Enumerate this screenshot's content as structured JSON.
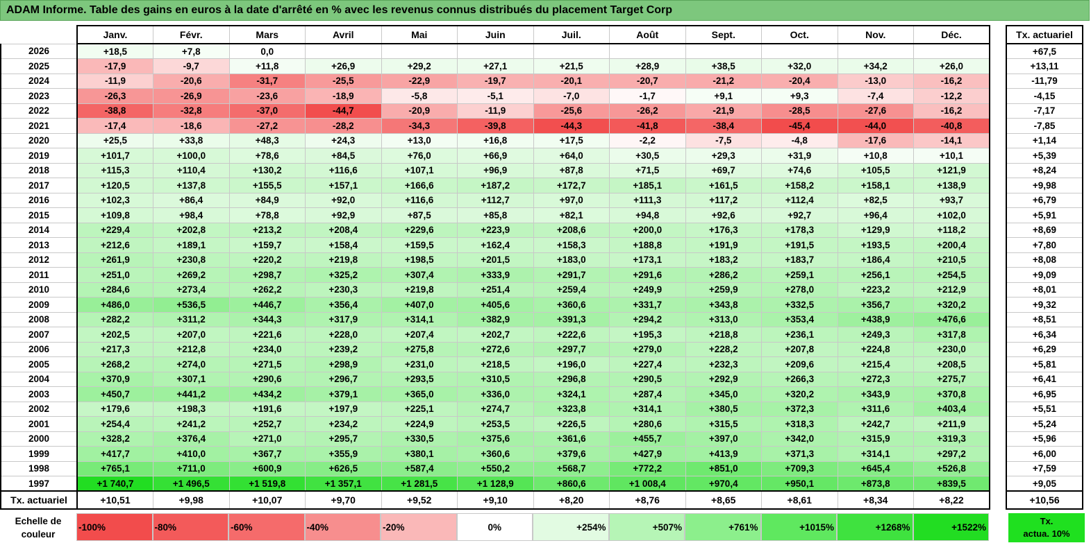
{
  "title": "ADAM Informe. Table des gains en euros à la date d'arrêté en % avec les revenus connus distribués du placement Target Corp",
  "months": [
    "Janv.",
    "Févr.",
    "Mars",
    "Avril",
    "Mai",
    "Juin",
    "Juil.",
    "Août",
    "Sept.",
    "Oct.",
    "Nov.",
    "Déc."
  ],
  "actuarial_header": "Tx. actuariel",
  "rows": [
    {
      "year": "2026",
      "values": [
        "+18,5",
        "+7,8",
        "0,0",
        "",
        "",
        "",
        "",
        "",
        "",
        "",
        "",
        ""
      ],
      "act": "+67,5"
    },
    {
      "year": "2025",
      "values": [
        "-17,9",
        "-9,7",
        "+11,8",
        "+26,9",
        "+29,2",
        "+27,1",
        "+21,5",
        "+28,9",
        "+38,5",
        "+32,0",
        "+34,2",
        "+26,0"
      ],
      "act": "+13,11"
    },
    {
      "year": "2024",
      "values": [
        "-11,9",
        "-20,6",
        "-31,7",
        "-25,5",
        "-22,9",
        "-19,7",
        "-20,1",
        "-20,7",
        "-21,2",
        "-20,4",
        "-13,0",
        "-16,2"
      ],
      "act": "-11,79"
    },
    {
      "year": "2023",
      "values": [
        "-26,3",
        "-26,9",
        "-23,6",
        "-18,9",
        "-5,8",
        "-5,1",
        "-7,0",
        "-1,7",
        "+9,1",
        "+9,3",
        "-7,4",
        "-12,2"
      ],
      "act": "-4,15"
    },
    {
      "year": "2022",
      "values": [
        "-38,8",
        "-32,8",
        "-37,0",
        "-44,7",
        "-20,9",
        "-11,9",
        "-25,6",
        "-26,2",
        "-21,9",
        "-28,5",
        "-27,6",
        "-16,2"
      ],
      "act": "-7,17"
    },
    {
      "year": "2021",
      "values": [
        "-17,4",
        "-18,6",
        "-27,2",
        "-28,2",
        "-34,3",
        "-39,8",
        "-44,3",
        "-41,8",
        "-38,4",
        "-45,4",
        "-44,0",
        "-40,8"
      ],
      "act": "-7,85"
    },
    {
      "year": "2020",
      "values": [
        "+25,5",
        "+33,8",
        "+48,3",
        "+24,3",
        "+13,0",
        "+16,8",
        "+17,5",
        "-2,2",
        "-7,5",
        "-4,8",
        "-17,6",
        "-14,1"
      ],
      "act": "+1,14"
    },
    {
      "year": "2019",
      "values": [
        "+101,7",
        "+100,0",
        "+78,6",
        "+84,5",
        "+76,0",
        "+66,9",
        "+64,0",
        "+30,5",
        "+29,3",
        "+31,9",
        "+10,8",
        "+10,1"
      ],
      "act": "+5,39"
    },
    {
      "year": "2018",
      "values": [
        "+115,3",
        "+110,4",
        "+130,2",
        "+116,6",
        "+107,1",
        "+96,9",
        "+87,8",
        "+71,5",
        "+69,7",
        "+74,6",
        "+105,5",
        "+121,9"
      ],
      "act": "+8,24"
    },
    {
      "year": "2017",
      "values": [
        "+120,5",
        "+137,8",
        "+155,5",
        "+157,1",
        "+166,6",
        "+187,2",
        "+172,7",
        "+185,1",
        "+161,5",
        "+158,2",
        "+158,1",
        "+138,9"
      ],
      "act": "+9,98"
    },
    {
      "year": "2016",
      "values": [
        "+102,3",
        "+86,4",
        "+84,9",
        "+92,0",
        "+116,6",
        "+112,7",
        "+97,0",
        "+111,3",
        "+117,2",
        "+112,4",
        "+82,5",
        "+93,7"
      ],
      "act": "+6,79"
    },
    {
      "year": "2015",
      "values": [
        "+109,8",
        "+98,4",
        "+78,8",
        "+92,9",
        "+87,5",
        "+85,8",
        "+82,1",
        "+94,8",
        "+92,6",
        "+92,7",
        "+96,4",
        "+102,0"
      ],
      "act": "+5,91"
    },
    {
      "year": "2014",
      "values": [
        "+229,4",
        "+202,8",
        "+213,2",
        "+208,4",
        "+229,6",
        "+223,9",
        "+208,6",
        "+200,0",
        "+176,3",
        "+178,3",
        "+129,9",
        "+118,2"
      ],
      "act": "+8,69"
    },
    {
      "year": "2013",
      "values": [
        "+212,6",
        "+189,1",
        "+159,7",
        "+158,4",
        "+159,5",
        "+162,4",
        "+158,3",
        "+188,8",
        "+191,9",
        "+191,5",
        "+193,5",
        "+200,4"
      ],
      "act": "+7,80"
    },
    {
      "year": "2012",
      "values": [
        "+261,9",
        "+230,8",
        "+220,2",
        "+219,8",
        "+198,5",
        "+201,5",
        "+183,0",
        "+173,1",
        "+183,2",
        "+183,7",
        "+186,4",
        "+210,5"
      ],
      "act": "+8,08"
    },
    {
      "year": "2011",
      "values": [
        "+251,0",
        "+269,2",
        "+298,7",
        "+325,2",
        "+307,4",
        "+333,9",
        "+291,7",
        "+291,6",
        "+286,2",
        "+259,1",
        "+256,1",
        "+254,5"
      ],
      "act": "+9,09"
    },
    {
      "year": "2010",
      "values": [
        "+284,6",
        "+273,4",
        "+262,2",
        "+230,3",
        "+219,8",
        "+251,4",
        "+259,4",
        "+249,9",
        "+259,9",
        "+278,0",
        "+223,2",
        "+212,9"
      ],
      "act": "+8,01"
    },
    {
      "year": "2009",
      "values": [
        "+486,0",
        "+536,5",
        "+446,7",
        "+356,4",
        "+407,0",
        "+405,6",
        "+360,6",
        "+331,7",
        "+343,8",
        "+332,5",
        "+356,7",
        "+320,2"
      ],
      "act": "+9,32"
    },
    {
      "year": "2008",
      "values": [
        "+282,2",
        "+311,2",
        "+344,3",
        "+317,9",
        "+314,1",
        "+382,9",
        "+391,3",
        "+294,2",
        "+313,0",
        "+353,4",
        "+438,9",
        "+476,6"
      ],
      "act": "+8,51"
    },
    {
      "year": "2007",
      "values": [
        "+202,5",
        "+207,0",
        "+221,6",
        "+228,0",
        "+207,4",
        "+202,7",
        "+222,6",
        "+195,3",
        "+218,8",
        "+236,1",
        "+249,3",
        "+317,8"
      ],
      "act": "+6,34"
    },
    {
      "year": "2006",
      "values": [
        "+217,3",
        "+212,8",
        "+234,0",
        "+239,2",
        "+275,8",
        "+272,6",
        "+297,7",
        "+279,0",
        "+228,2",
        "+207,8",
        "+224,8",
        "+230,0"
      ],
      "act": "+6,29"
    },
    {
      "year": "2005",
      "values": [
        "+268,2",
        "+274,0",
        "+271,5",
        "+298,9",
        "+231,0",
        "+218,5",
        "+196,0",
        "+227,4",
        "+232,3",
        "+209,6",
        "+215,4",
        "+208,5"
      ],
      "act": "+5,81"
    },
    {
      "year": "2004",
      "values": [
        "+370,9",
        "+307,1",
        "+290,6",
        "+296,7",
        "+293,5",
        "+310,5",
        "+296,8",
        "+290,5",
        "+292,9",
        "+266,3",
        "+272,3",
        "+275,7"
      ],
      "act": "+6,41"
    },
    {
      "year": "2003",
      "values": [
        "+450,7",
        "+441,2",
        "+434,2",
        "+379,1",
        "+365,0",
        "+336,0",
        "+324,1",
        "+287,4",
        "+345,0",
        "+320,2",
        "+343,9",
        "+370,8"
      ],
      "act": "+6,95"
    },
    {
      "year": "2002",
      "values": [
        "+179,6",
        "+198,3",
        "+191,6",
        "+197,9",
        "+225,1",
        "+274,7",
        "+323,8",
        "+314,1",
        "+380,5",
        "+372,3",
        "+311,6",
        "+403,4"
      ],
      "act": "+5,51"
    },
    {
      "year": "2001",
      "values": [
        "+254,4",
        "+241,2",
        "+252,7",
        "+234,2",
        "+224,9",
        "+253,5",
        "+226,5",
        "+280,6",
        "+315,5",
        "+318,3",
        "+242,7",
        "+211,9"
      ],
      "act": "+5,24"
    },
    {
      "year": "2000",
      "values": [
        "+328,2",
        "+376,4",
        "+271,0",
        "+295,7",
        "+330,5",
        "+375,6",
        "+361,6",
        "+455,7",
        "+397,0",
        "+342,0",
        "+315,9",
        "+319,3"
      ],
      "act": "+5,96"
    },
    {
      "year": "1999",
      "values": [
        "+417,7",
        "+410,0",
        "+367,7",
        "+355,9",
        "+380,1",
        "+360,6",
        "+379,6",
        "+427,9",
        "+413,9",
        "+371,3",
        "+314,1",
        "+297,2"
      ],
      "act": "+6,00"
    },
    {
      "year": "1998",
      "values": [
        "+765,1",
        "+711,0",
        "+600,9",
        "+626,5",
        "+587,4",
        "+550,2",
        "+568,7",
        "+772,2",
        "+851,0",
        "+709,3",
        "+645,4",
        "+526,8"
      ],
      "act": "+7,59"
    },
    {
      "year": "1997",
      "values": [
        "+1 740,7",
        "+1 496,5",
        "+1 519,8",
        "+1 357,1",
        "+1 281,5",
        "+1 128,9",
        "+860,6",
        "+1 008,4",
        "+970,4",
        "+950,1",
        "+873,8",
        "+839,5"
      ],
      "act": "+9,05"
    }
  ],
  "summary": {
    "label": "Tx. actuariel",
    "values": [
      "+10,51",
      "+9,98",
      "+10,07",
      "+9,70",
      "+9,52",
      "+9,10",
      "+8,20",
      "+8,76",
      "+8,65",
      "+8,61",
      "+8,34",
      "+8,22"
    ],
    "act": "+10,56"
  },
  "legend": {
    "label_line1": "Echelle de",
    "label_line2": "couleur",
    "swatches": [
      {
        "text": "-100%",
        "color": "#f24c4c"
      },
      {
        "text": "-80%",
        "color": "#f35a5a"
      },
      {
        "text": "-60%",
        "color": "#f56b6b"
      },
      {
        "text": "-40%",
        "color": "#f78e8e"
      },
      {
        "text": "-20%",
        "color": "#fab8b8"
      },
      {
        "text": "0%",
        "color": "#ffffff"
      },
      {
        "text": "+254%",
        "color": "#e2fbe2"
      },
      {
        "text": "+507%",
        "color": "#b6f5b6"
      },
      {
        "text": "+761%",
        "color": "#8cef8c"
      },
      {
        "text": "+1015%",
        "color": "#5fe85f"
      },
      {
        "text": "+1268%",
        "color": "#3fe23f"
      },
      {
        "text": "+1522%",
        "color": "#22dd22"
      }
    ],
    "act_line1": "Tx.",
    "act_line2": "actua. 10%",
    "act_color": "#1fe01f"
  },
  "colors": {
    "title_bg": "#7dc77d",
    "negative": "#f24c4c",
    "positive": "#22dd22"
  }
}
